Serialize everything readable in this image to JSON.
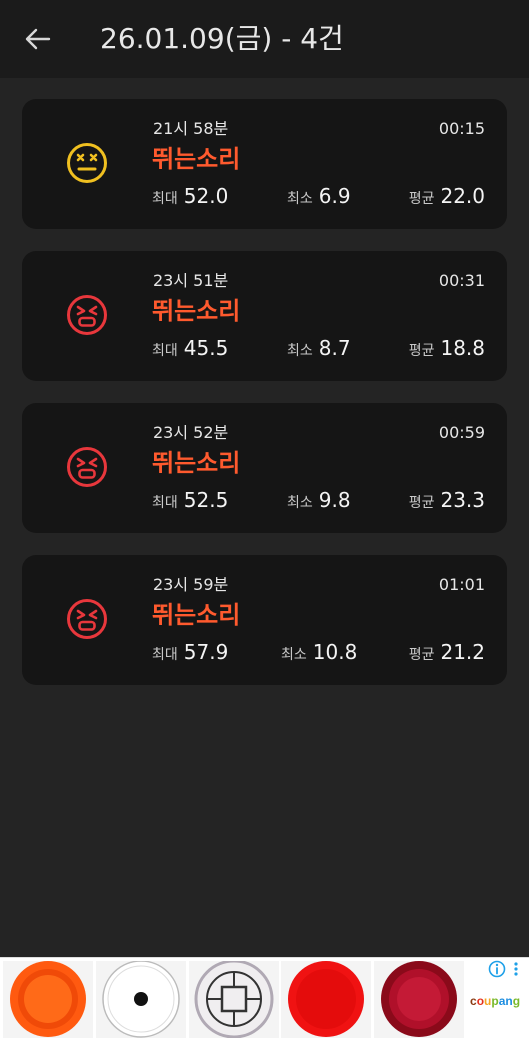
{
  "header": {
    "title": "26.01.09(금) - 4건"
  },
  "records": [
    {
      "mood": "neutral",
      "icon": "dizzy-face-icon",
      "color": "#f0c020",
      "time": "21시 58분",
      "duration": "00:15",
      "type": "뛰는소리",
      "max_label": "최대",
      "max": "52.0",
      "min_label": "최소",
      "min": "6.9",
      "avg_label": "평균",
      "avg": "22.0"
    },
    {
      "mood": "angry",
      "icon": "angry-face-icon",
      "color": "#e8373c",
      "time": "23시 51분",
      "duration": "00:31",
      "type": "뛰는소리",
      "max_label": "최대",
      "max": "45.5",
      "min_label": "최소",
      "min": "8.7",
      "avg_label": "평균",
      "avg": "18.8"
    },
    {
      "mood": "angry",
      "icon": "angry-face-icon",
      "color": "#e8373c",
      "time": "23시 52분",
      "duration": "00:59",
      "type": "뛰는소리",
      "max_label": "최대",
      "max": "52.5",
      "min_label": "최소",
      "min": "9.8",
      "avg_label": "평균",
      "avg": "23.3"
    },
    {
      "mood": "angry",
      "icon": "angry-face-icon",
      "color": "#e8373c",
      "time": "23시 59분",
      "duration": "01:01",
      "type": "뛰는소리",
      "max_label": "최대",
      "max": "57.9",
      "min_label": "최소",
      "min": "10.8",
      "avg_label": "평균",
      "avg": "21.2"
    }
  ],
  "ad": {
    "brand": "coupang",
    "products": [
      "orange-dish",
      "white-plate-with-dot",
      "square-pattern-plate",
      "red-dish",
      "burgundy-dish"
    ],
    "colors": {
      "orange": "#ff5a10",
      "red": "#f01212",
      "burgundy": "#b0102a"
    }
  },
  "theme": {
    "accent": "#ff5a2e",
    "background": "#242424",
    "card": "#151515"
  }
}
